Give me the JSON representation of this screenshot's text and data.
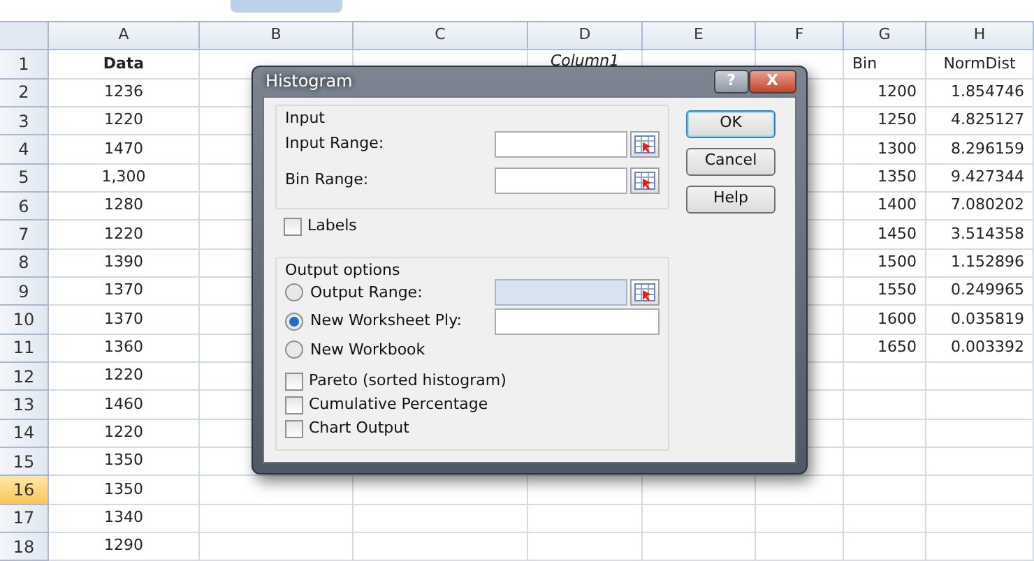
{
  "sheet": {
    "columns": [
      "A",
      "B",
      "C",
      "D",
      "E",
      "F",
      "G",
      "H"
    ],
    "rows": [
      {
        "number": "1",
        "selected": false,
        "cells": {
          "A": "Data",
          "D": "Column1",
          "G": "Bin",
          "H": "NormDist"
        }
      },
      {
        "number": "2",
        "selected": false,
        "cells": {
          "A": "1236",
          "G": "1200",
          "H": "1.854746"
        }
      },
      {
        "number": "3",
        "selected": false,
        "cells": {
          "A": "1220",
          "G": "1250",
          "H": "4.825127"
        }
      },
      {
        "number": "4",
        "selected": false,
        "cells": {
          "A": "1470",
          "G": "1300",
          "H": "8.296159"
        }
      },
      {
        "number": "5",
        "selected": false,
        "cells": {
          "A": "1,300",
          "G": "1350",
          "H": "9.427344"
        }
      },
      {
        "number": "6",
        "selected": false,
        "cells": {
          "A": "1280",
          "G": "1400",
          "H": "7.080202"
        }
      },
      {
        "number": "7",
        "selected": false,
        "cells": {
          "A": "1220",
          "G": "1450",
          "H": "3.514358"
        }
      },
      {
        "number": "8",
        "selected": false,
        "cells": {
          "A": "1390",
          "G": "1500",
          "H": "1.152896"
        }
      },
      {
        "number": "9",
        "selected": false,
        "cells": {
          "A": "1370",
          "G": "1550",
          "H": "0.249965"
        }
      },
      {
        "number": "10",
        "selected": false,
        "cells": {
          "A": "1370",
          "G": "1600",
          "H": "0.035819"
        }
      },
      {
        "number": "11",
        "selected": false,
        "cells": {
          "A": "1360",
          "G": "1650",
          "H": "0.003392"
        }
      },
      {
        "number": "12",
        "selected": false,
        "cells": {
          "A": "1220"
        }
      },
      {
        "number": "13",
        "selected": false,
        "cells": {
          "A": "1460"
        }
      },
      {
        "number": "14",
        "selected": false,
        "cells": {
          "A": "1220"
        }
      },
      {
        "number": "15",
        "selected": false,
        "cells": {
          "A": "1350"
        }
      },
      {
        "number": "16",
        "selected": true,
        "cells": {
          "A": "1350"
        }
      },
      {
        "number": "17",
        "selected": false,
        "cells": {
          "A": "1340"
        }
      },
      {
        "number": "18",
        "selected": false,
        "cells": {
          "A": "1290"
        }
      }
    ]
  },
  "dialog": {
    "title": "Histogram",
    "help_button": "?",
    "close_button": "X",
    "input_group": {
      "title": "Input",
      "fields": [
        {
          "label": "Input Range:",
          "disabled": false
        },
        {
          "label": "Bin Range:",
          "disabled": false
        }
      ]
    },
    "labels_checkbox": {
      "label": "Labels",
      "checked": false
    },
    "output_group": {
      "title": "Output options",
      "options": [
        {
          "label": "Output Range:",
          "selected": false,
          "kind": "picker"
        },
        {
          "label": "New Worksheet Ply:",
          "selected": true,
          "kind": "plain"
        },
        {
          "label": "New Workbook",
          "selected": false,
          "kind": "bare"
        }
      ],
      "checkboxes": [
        {
          "label": "Pareto (sorted histogram)",
          "checked": false
        },
        {
          "label": "Cumulative Percentage",
          "checked": false
        },
        {
          "label": "Chart Output",
          "checked": false
        }
      ]
    },
    "buttons": [
      {
        "label": "OK",
        "focused": true
      },
      {
        "label": "Cancel",
        "focused": false
      },
      {
        "label": "Help",
        "focused": false
      }
    ]
  }
}
